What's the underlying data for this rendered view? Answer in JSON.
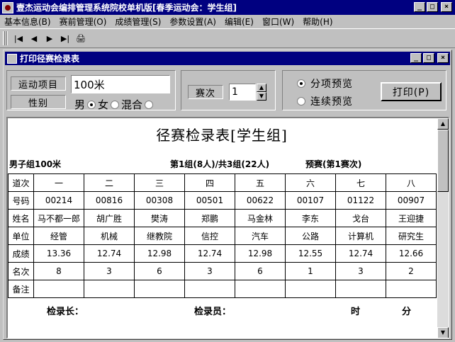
{
  "app": {
    "title": "壹杰运动会编排管理系统院校单机版[春季运动会：学生组]",
    "min": "_",
    "max": "□",
    "close": "×"
  },
  "menu": [
    "基本信息(B)",
    "赛前管理(O)",
    "成绩管理(S)",
    "参数设置(A)",
    "编辑(E)",
    "窗口(W)",
    "帮助(H)"
  ],
  "toolbar": {
    "first": "|◀",
    "prev": "◀",
    "next": "▶",
    "last": "▶|",
    "print": "🖨"
  },
  "child": {
    "title": "打印径赛检录表",
    "min": "_",
    "max": "□",
    "close": "×"
  },
  "form": {
    "event_label": "运动项目",
    "event_value": "100米",
    "gender_label": "性别",
    "gender_options": [
      "男",
      "女",
      "混合"
    ],
    "heat_label": "赛次",
    "heat_value": "1",
    "preview_single": "分项预览",
    "preview_continuous": "连续预览",
    "print_button": "打印(P)"
  },
  "report": {
    "title": "径赛检录表[学生组]",
    "group": "男子组100米",
    "heat_info": "第1组(8人)/共3组(22人)",
    "round": "预赛(第1赛次)",
    "row_headers": [
      "道次",
      "号码",
      "姓名",
      "单位",
      "成绩",
      "名次",
      "备注"
    ],
    "lanes": [
      "一",
      "二",
      "三",
      "四",
      "五",
      "六",
      "七",
      "八"
    ],
    "numbers": [
      "00214",
      "00816",
      "00308",
      "00501",
      "00622",
      "00107",
      "01122",
      "00907"
    ],
    "names": [
      "马不都一郎",
      "胡广胜",
      "樊涛",
      "郑鹏",
      "马金林",
      "李东",
      "戈台",
      "王迎捷"
    ],
    "units": [
      "经管",
      "机械",
      "继教院",
      "信控",
      "汽车",
      "公路",
      "计算机",
      "研究生"
    ],
    "results": [
      "13.36",
      "12.74",
      "12.98",
      "12.74",
      "12.98",
      "12.55",
      "12.74",
      "12.66"
    ],
    "ranks": [
      "8",
      "3",
      "6",
      "3",
      "6",
      "1",
      "3",
      "2"
    ],
    "remarks": [
      "",
      "",
      "",
      "",
      "",
      "",
      "",
      ""
    ],
    "checker_chief": "检录长：",
    "checker": "检录员：",
    "hour": "时",
    "minute": "分"
  }
}
